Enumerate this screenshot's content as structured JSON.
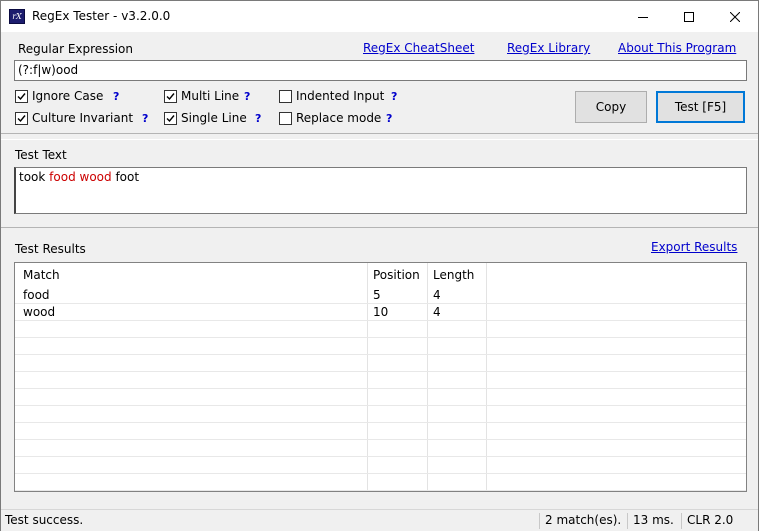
{
  "window": {
    "title": "RegEx Tester - v3.2.0.0",
    "icon_text": "rX"
  },
  "regex": {
    "label": "Regular Expression",
    "value": "(?:f|w)ood",
    "links": {
      "cheatsheet": "RegEx CheatSheet",
      "library": "RegEx Library",
      "about": "About This Program"
    },
    "options": {
      "ignore_case": {
        "label": "Ignore Case",
        "checked": true
      },
      "culture_invariant": {
        "label": "Culture Invariant",
        "checked": true
      },
      "multi_line": {
        "label": "Multi Line",
        "checked": true
      },
      "single_line": {
        "label": "Single Line",
        "checked": true
      },
      "indented_input": {
        "label": "Indented Input",
        "checked": false
      },
      "replace_mode": {
        "label": "Replace mode",
        "checked": false
      }
    },
    "help_mark": "?",
    "buttons": {
      "copy": "Copy",
      "test": "Test [F5]"
    }
  },
  "test_text": {
    "label": "Test Text",
    "segments": {
      "s1": "took ",
      "s2": "food",
      "s3": " ",
      "s4": "wood",
      "s5": " foot"
    }
  },
  "results": {
    "label": "Test Results",
    "export_link": "Export Results",
    "columns": {
      "match": "Match",
      "position": "Position",
      "length": "Length"
    },
    "rows": [
      {
        "match": "food",
        "position": "5",
        "length": "4"
      },
      {
        "match": "wood",
        "position": "10",
        "length": "4"
      }
    ]
  },
  "status": {
    "message": "Test success.",
    "matches": "2 match(es).",
    "time": "13 ms.",
    "clr": "CLR 2.0"
  },
  "colors": {
    "highlight": "#cc0000",
    "link": "#0000cc",
    "default_button_border": "#0078d7"
  }
}
